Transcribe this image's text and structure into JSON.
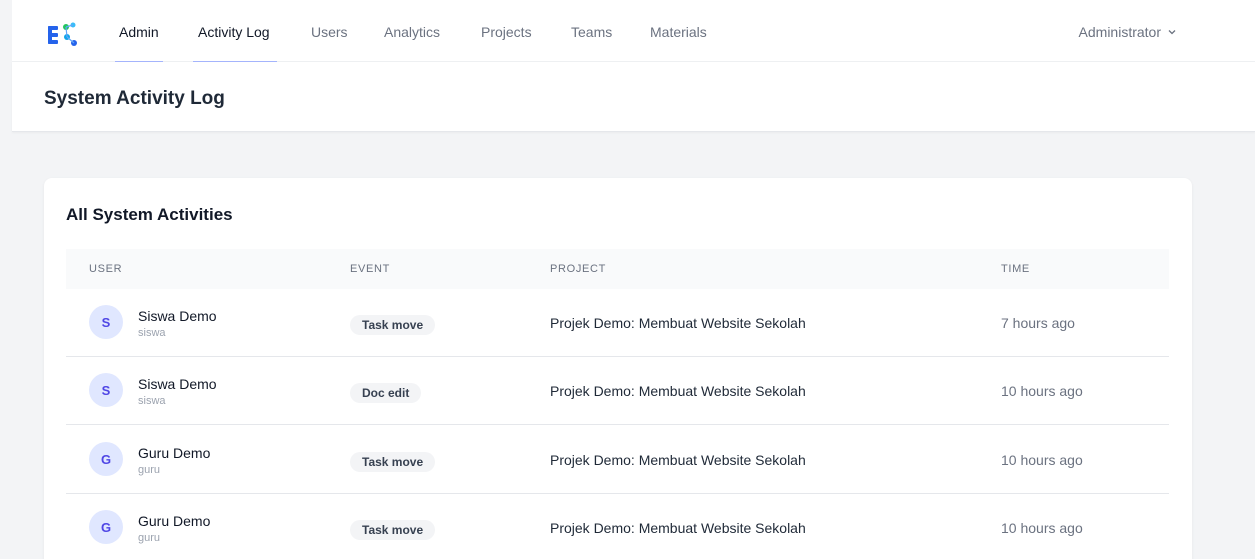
{
  "nav": {
    "items": [
      {
        "label": "Admin",
        "active": true
      },
      {
        "label": "Activity Log",
        "active": true
      },
      {
        "label": "Users",
        "active": false
      },
      {
        "label": "Analytics",
        "active": false
      },
      {
        "label": "Projects",
        "active": false
      },
      {
        "label": "Teams",
        "active": false
      },
      {
        "label": "Materials",
        "active": false
      }
    ],
    "user_menu": "Administrator",
    "user_menu_icon": "chevron-down-icon",
    "logo_icon": "network-logo-icon"
  },
  "header": {
    "title": "System Activity Log"
  },
  "card": {
    "title": "All System Activities",
    "columns": [
      "USER",
      "EVENT",
      "PROJECT",
      "TIME"
    ],
    "rows": [
      {
        "initial": "S",
        "name": "Siswa Demo",
        "username": "siswa",
        "event": "Task move",
        "project": "Projek Demo: Membuat Website Sekolah",
        "time": "7 hours ago"
      },
      {
        "initial": "S",
        "name": "Siswa Demo",
        "username": "siswa",
        "event": "Doc edit",
        "project": "Projek Demo: Membuat Website Sekolah",
        "time": "10 hours ago"
      },
      {
        "initial": "G",
        "name": "Guru Demo",
        "username": "guru",
        "event": "Task move",
        "project": "Projek Demo: Membuat Website Sekolah",
        "time": "10 hours ago"
      },
      {
        "initial": "G",
        "name": "Guru Demo",
        "username": "guru",
        "event": "Task move",
        "project": "Projek Demo: Membuat Website Sekolah",
        "time": "10 hours ago"
      }
    ]
  },
  "colors": {
    "accent": "#4f46e5",
    "accent_light": "#e0e7ff",
    "nav_underline": "#a5b4fc",
    "background": "#f3f4f6"
  }
}
